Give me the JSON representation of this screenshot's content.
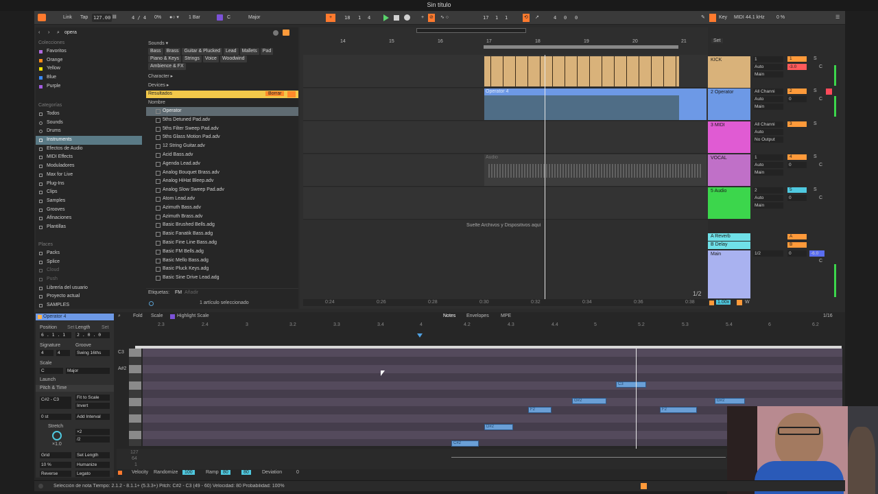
{
  "window": {
    "title": "Sin título"
  },
  "transport": {
    "link": "Link",
    "tap": "Tap",
    "tempo": "127.00",
    "meter": "4 / 4",
    "percent": "0%",
    "quantize": "1 Bar",
    "key": "C",
    "scale": "Major",
    "position": [
      "18",
      "1",
      "4"
    ],
    "loop_start": [
      "17",
      "1",
      "1"
    ],
    "loop_len": [
      "4",
      "0",
      "0"
    ],
    "key_label": "Key",
    "midi_label": "MIDI",
    "sample_rate": "44.1 kHz",
    "cpu": "0 %"
  },
  "browser": {
    "search": "opera",
    "collections_header": "Colecciones",
    "collections": [
      {
        "label": "Favoritos",
        "color": "#b06be0"
      },
      {
        "label": "Orange",
        "color": "#ff8c1a"
      },
      {
        "label": "Yellow",
        "color": "#f0e000"
      },
      {
        "label": "Blue",
        "color": "#3a8aff"
      },
      {
        "label": "Purple",
        "color": "#a35ce0"
      }
    ],
    "categories_header": "Categorías",
    "categories": [
      "Todos",
      "Sounds",
      "Drums",
      "Instruments",
      "Efectos de Audio",
      "MIDI Effects",
      "Moduladores",
      "Max for Live",
      "Plug-Ins",
      "Clips",
      "Samples",
      "Grooves",
      "Afinaciones",
      "Plantillas"
    ],
    "selected_category": "Instruments",
    "places_header": "Places",
    "places": [
      "Packs",
      "Splice",
      "Cloud",
      "Push",
      "Librería del usuario",
      "Proyecto actual",
      "SAMPLES"
    ],
    "filter_sounds": "Sounds ▾",
    "sound_tags_1": [
      "Bass",
      "Brass",
      "Guitar & Plucked",
      "Lead",
      "Mallets",
      "Pad"
    ],
    "sound_tags_2": [
      "Piano & Keys",
      "Strings",
      "Voice",
      "Woodwind"
    ],
    "sound_tags_3": [
      "Ambience & FX"
    ],
    "character": "Character ▸",
    "devices": "Devices ▸",
    "results_label": "Resultados",
    "clear_label": "Borrar",
    "name_col": "Nombre",
    "results": [
      "Operator",
      "5ths Detuned Pad.adv",
      "5ths Filter Sweep Pad.adv",
      "5ths Glass Motion Pad.adv",
      "12 String Guitar.adv",
      "Acid Bass.adv",
      "Agenda Lead.adv",
      "Analog Bouquet Brass.adv",
      "Analog HiHat Bleep.adv",
      "Analog Slow Sweep Pad.adv",
      "Atom Lead.adv",
      "Azimuth Bass.adv",
      "Azimuth Brass.adv",
      "Basic Brushed Bells.adg",
      "Basic Fanatik Bass.adg",
      "Basic Fine Line Bass.adg",
      "Basic FM Bells.adg",
      "Basic Mello Bass.adg",
      "Basic Pluck Keys.adg",
      "Basic Sine Drive Lead.adg"
    ],
    "tags_label": "Etiquetas:",
    "tag_fm": "FM",
    "tag_add": "Añadir",
    "selected_count": "1 artículo seleccionado"
  },
  "arrangement": {
    "bars": [
      "14",
      "15",
      "16",
      "17",
      "18",
      "19",
      "20",
      "21"
    ],
    "clip_label": "Operator 4",
    "audio_label": "Audio",
    "drop_hint": "Suelte Archivos y Dispositivos aquí",
    "zoom_label": "1/2",
    "times": [
      "0:24",
      "0:26",
      "0:28",
      "0:30",
      "0:32",
      "0:34",
      "0:36",
      "0:38"
    ]
  },
  "mixer": {
    "set_label": "Set",
    "tracks": [
      {
        "name": "KICK",
        "color": "#d9b27a",
        "num": "1",
        "in1": "1",
        "mode": "Auto",
        "route": "Main",
        "vol": "-3.0",
        "pan": "C",
        "active_color": "#ff9a3a"
      },
      {
        "name": "2 Operator",
        "color": "#6d99e6",
        "num": "2",
        "in1": "All Channi",
        "mode": "Auto",
        "route": "Main",
        "vol": "0",
        "pan": "C",
        "active_color": "#ff9a3a"
      },
      {
        "name": "3 MIDI",
        "color": "#e05bd3",
        "num": "3",
        "in1": "All Channi",
        "mode": "Auto",
        "route": "No Output",
        "vol": "",
        "pan": "",
        "active_color": "#ff9a3a"
      },
      {
        "name": "VOCAL",
        "color": "#c070c8",
        "num": "4",
        "in1": "1",
        "mode": "Auto",
        "route": "Main",
        "vol": "0",
        "pan": "C",
        "active_color": "#ff9a3a"
      },
      {
        "name": "5 Audio",
        "color": "#3cd64c",
        "num": "5",
        "in1": "2",
        "mode": "Auto",
        "route": "Main",
        "vol": "0",
        "pan": "C",
        "active_color": "#4fc9e0"
      }
    ],
    "returns": [
      {
        "name": "A Reverb",
        "color": "#6fe0e8",
        "letter": "A"
      },
      {
        "name": "B Delay",
        "color": "#6fe0e8",
        "letter": "B"
      }
    ],
    "main": {
      "name": "Main",
      "color": "#a9b2f0",
      "route": "1/2",
      "vol": "0",
      "pan": "C",
      "peak": "-6.0"
    },
    "tempo_ratio": "1.00x",
    "s_label": "S",
    "w_label": "W"
  },
  "clip": {
    "name": "Operator 4",
    "toolbar": {
      "fold": "Fold",
      "scale": "Scale",
      "highlight": "Highlight Scale",
      "notes": "Notes",
      "envelopes": "Envelopes",
      "mpe": "MPE",
      "grid": "1/16"
    },
    "position_label": "Position",
    "set1": "Set",
    "length_label": "Length",
    "set2": "Set",
    "position_val": "6 . 1 . 1",
    "length_val": "2 . 0 . 0",
    "signature_label": "Signature",
    "groove_label": "Groove",
    "sig_num": "4",
    "sig_den": "4",
    "groove_val": "Swing 16ths",
    "scale_label": "Scale",
    "scale_key": "C",
    "scale_mode": "Major",
    "launch_label": "Launch",
    "pitch_time_label": "Pitch & Time",
    "range": "C#2 - C3",
    "fit_scale": "Fit to Scale",
    "invert": "Invert",
    "transpose": "0 st",
    "add_interval": "Add Interval",
    "stretch": "Stretch",
    "x2": "×2",
    "div2": "/2",
    "stretch_val": "×1.0",
    "grid_label": "Grid",
    "set_length": "Set Length",
    "humanize_pct": "10 %",
    "humanize": "Humanize",
    "reverse": "Reverse",
    "legato": "Legato",
    "ruler": [
      "2.3",
      "2.4",
      "3",
      "3.2",
      "3.3",
      "3.4",
      "4",
      "4.2",
      "4.3",
      "4.4",
      "5",
      "5.2",
      "5.3",
      "5.4",
      "6",
      "6.2"
    ],
    "pitch_labels": [
      "C3",
      "A#2"
    ],
    "vel_labels": [
      "127",
      "64",
      "1"
    ],
    "notes": [
      {
        "label": "C#2"
      },
      {
        "label": "D#2"
      },
      {
        "label": "F2"
      },
      {
        "label": "G#2"
      },
      {
        "label": "C3"
      },
      {
        "label": "F2"
      },
      {
        "label": "G#2"
      }
    ],
    "footer": {
      "velocity": "Velocity",
      "randomize": "Randomize",
      "rand_val": "100",
      "ramp": "Ramp",
      "ramp_a": "80",
      "ramp_b": "80",
      "deviation": "Deviation",
      "dev_val": "0"
    }
  },
  "status": {
    "text": "Selección de nota   Tiempo: 2.1.2 - 8.1.1+ (5.3.3+)   Pitch: C#2 - C3 (49 - 60)   Velocidad: 80   Probabilidad: 100%"
  }
}
